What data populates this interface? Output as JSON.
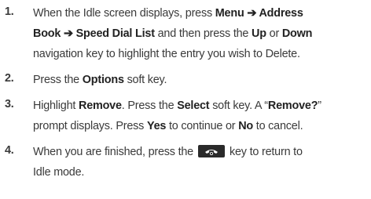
{
  "steps": [
    {
      "number": "1.",
      "line1": {
        "a": "When the Idle screen displays, press ",
        "b1": "Menu",
        "arrow1": " ➔ ",
        "b2": "Address"
      },
      "line2": {
        "b1": "Book",
        "arrow1": " ➔ ",
        "b2": "Speed Dial List",
        "a": " and then press the ",
        "b3": "Up",
        "c": " or ",
        "b4": "Down"
      },
      "line3": {
        "a": "navigation key to highlight the entry you wish to Delete."
      }
    },
    {
      "number": "2.",
      "line1": {
        "a": " Press the ",
        "b1": "Options",
        "c": " soft key."
      }
    },
    {
      "number": "3.",
      "line1": {
        "a": "Highlight ",
        "b1": "Remove",
        "c": ". Press the ",
        "b2": "Select",
        "d": " soft key. A “",
        "b3": "Remove?",
        "e": "”"
      },
      "line2": {
        "a": "prompt displays. Press ",
        "b1": "Yes",
        "c": " to continue or ",
        "b2": "No",
        "d": " to cancel."
      }
    },
    {
      "number": "4.",
      "line1": {
        "a": "When you are finished, press the",
        "icon": "end-key-icon",
        "c": "key to return to"
      },
      "line2": {
        "a": "Idle mode."
      }
    }
  ]
}
